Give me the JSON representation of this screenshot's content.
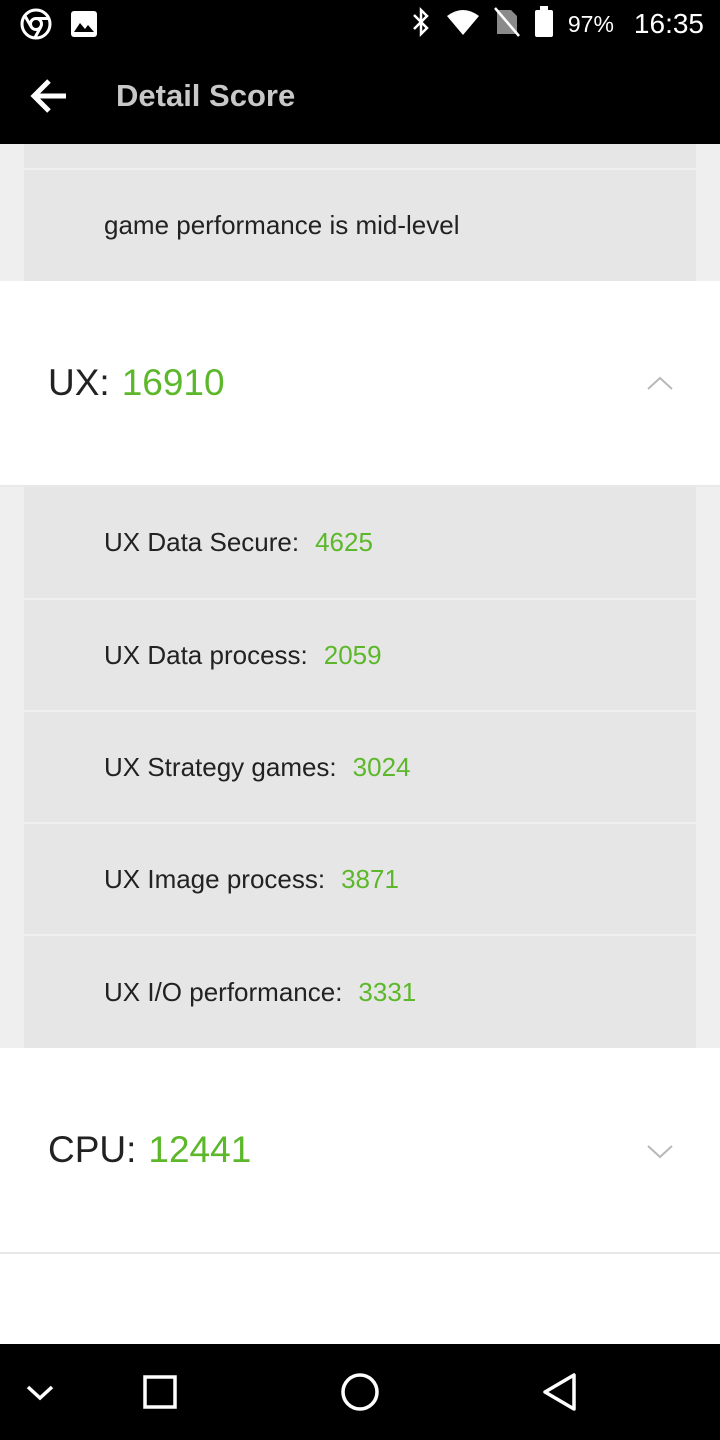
{
  "status_bar": {
    "icons_left": [
      "chrome-icon",
      "image-icon"
    ],
    "icons_right": [
      "bluetooth-icon",
      "wifi-icon",
      "no-sim-icon",
      "battery-icon"
    ],
    "battery": "97%",
    "time": "16:35"
  },
  "app_bar": {
    "back_icon": "arrow-back-icon",
    "title": "Detail Score"
  },
  "game_section": {
    "note": "game performance is mid-level"
  },
  "ux_section": {
    "label": "UX:",
    "score": "16910",
    "expanded": true,
    "items": [
      {
        "label": "UX Data Secure:",
        "value": "4625"
      },
      {
        "label": "UX Data process:",
        "value": "2059"
      },
      {
        "label": "UX Strategy games:",
        "value": "3024"
      },
      {
        "label": "UX Image process:",
        "value": "3871"
      },
      {
        "label": "UX I/O performance:",
        "value": "3331"
      }
    ]
  },
  "cpu_section": {
    "label": "CPU:",
    "score": "12441",
    "expanded": false
  },
  "nav_bar": {
    "buttons": [
      "collapse-icon",
      "recents-icon",
      "home-icon",
      "back-icon"
    ]
  },
  "colors": {
    "score_green": "#5cb82a",
    "bar_black": "#000000",
    "row_grey": "#e6e6e6"
  }
}
